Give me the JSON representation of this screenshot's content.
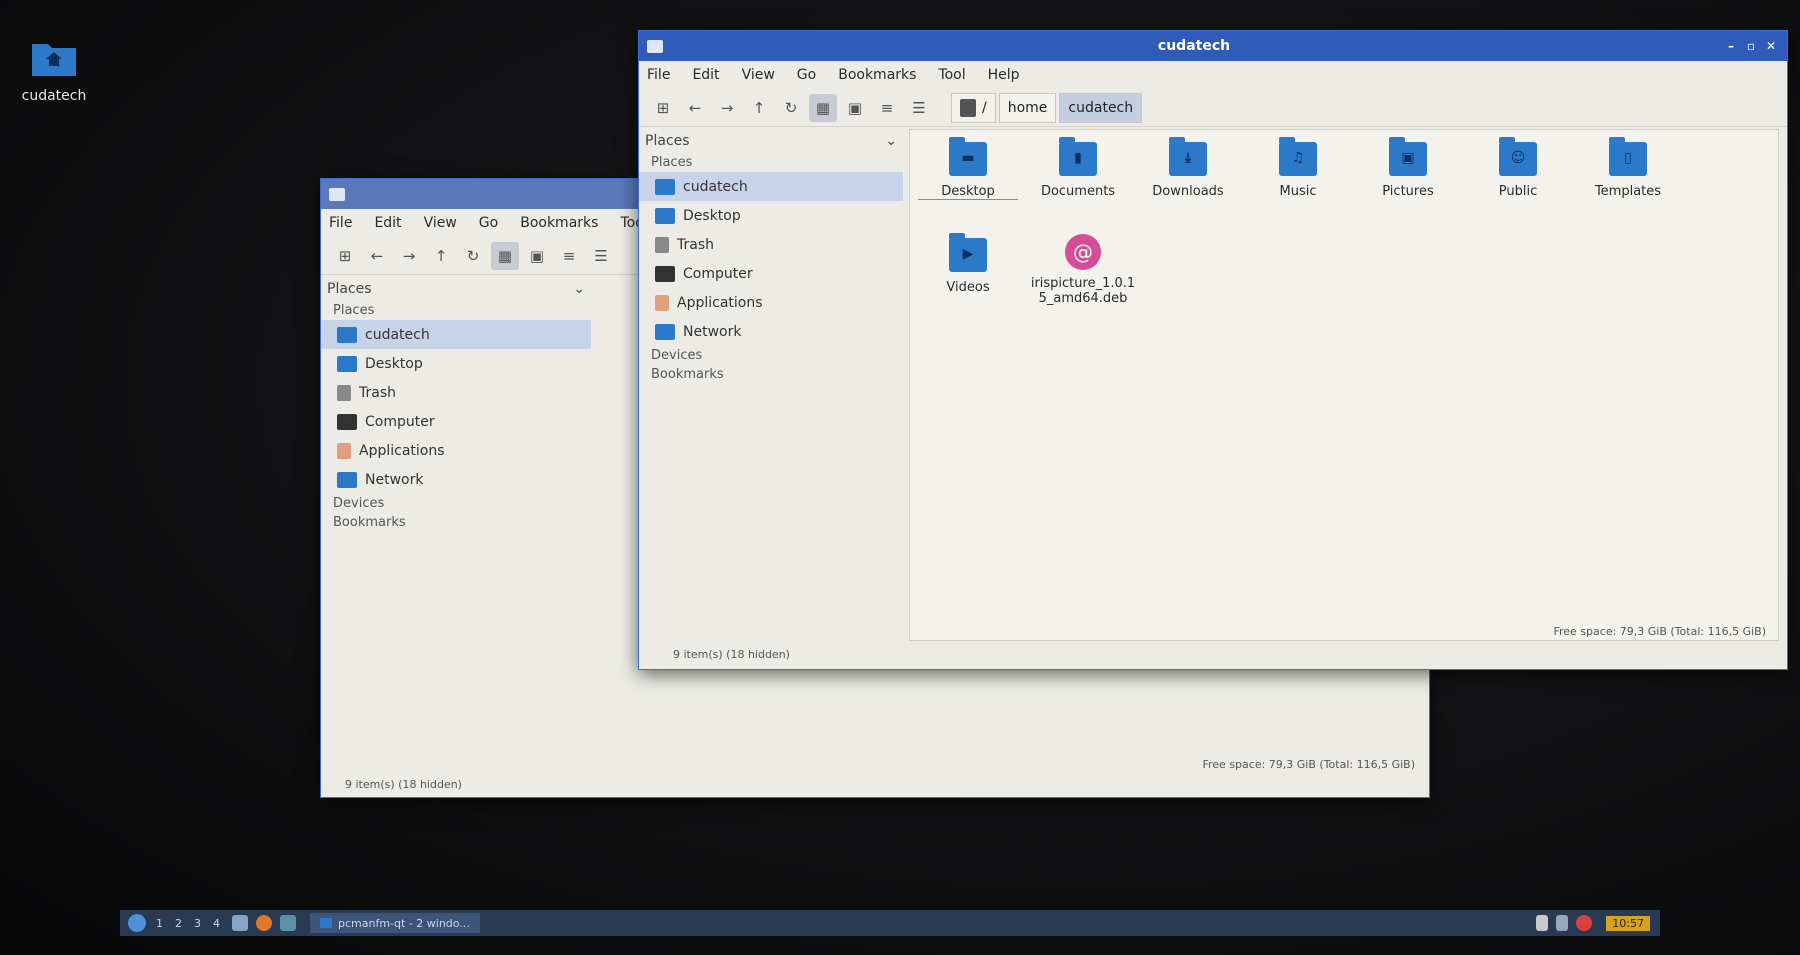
{
  "desktop": {
    "icon_label": "cudatech"
  },
  "back_window": {
    "menu": [
      "File",
      "Edit",
      "View",
      "Go",
      "Bookmarks",
      "Tool"
    ],
    "sidebar_header": "Places",
    "section_places": "Places",
    "places": [
      "cudatech",
      "Desktop",
      "Trash",
      "Computer",
      "Applications",
      "Network"
    ],
    "devices": "Devices",
    "bookmarks": "Bookmarks",
    "status_left": "9 item(s) (18 hidden)",
    "status_right": "Free space: 79,3 GiB (Total: 116,5 GiB)"
  },
  "front_window": {
    "title": "cudatech",
    "menu": [
      "File",
      "Edit",
      "View",
      "Go",
      "Bookmarks",
      "Tool",
      "Help"
    ],
    "path": [
      "/",
      "home",
      "cudatech"
    ],
    "sidebar_header": "Places",
    "section_places": "Places",
    "places": [
      "cudatech",
      "Desktop",
      "Trash",
      "Computer",
      "Applications",
      "Network"
    ],
    "devices": "Devices",
    "bookmarks": "Bookmarks",
    "files": [
      "Desktop",
      "Documents",
      "Downloads",
      "Music",
      "Pictures",
      "Public",
      "Templates",
      "Videos",
      "irispicture_1.0.15_amd64.deb"
    ],
    "status_left": "9 item(s) (18 hidden)",
    "status_right": "Free space: 79,3 GiB (Total: 116,5 GiB)"
  },
  "taskbar": {
    "workspaces": [
      "1",
      "2",
      "3",
      "4"
    ],
    "task_label": "pcmanfm-qt - 2 windo...",
    "clock": "10:57"
  },
  "colors": {
    "titlebar": "#2f5cb8",
    "folder": "#2b79c8",
    "selection": "#c6d3e8"
  }
}
